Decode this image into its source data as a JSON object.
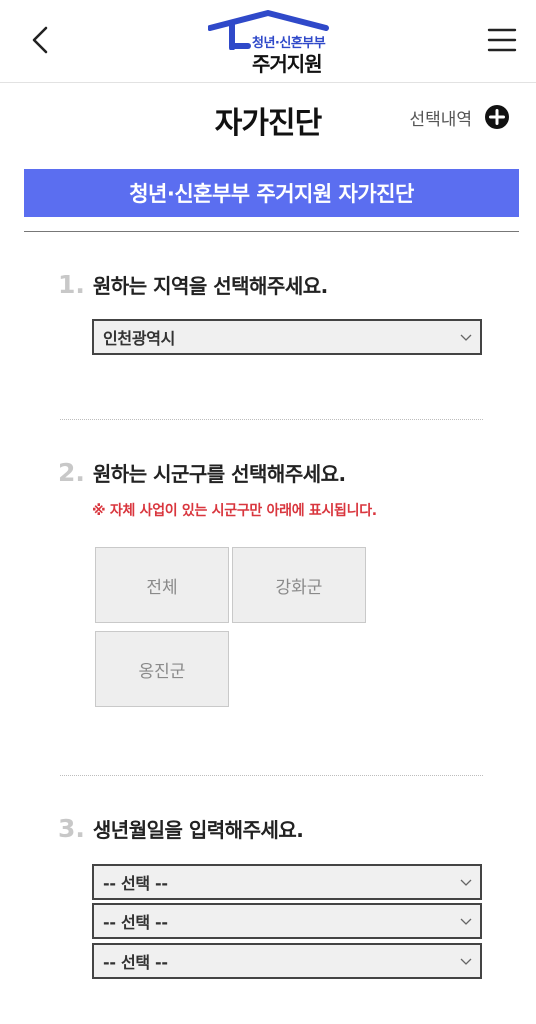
{
  "header": {
    "logo_line1": "청년·신혼부부",
    "logo_line2": "주거지원",
    "colors": {
      "brand_blue": "#2f49c9"
    }
  },
  "page": {
    "title": "자가진단",
    "history_label": "선택내역"
  },
  "banner": {
    "text": "청년·신혼부부 주거지원 자가진단",
    "color": "#5b6ef0"
  },
  "q1": {
    "number": "1.",
    "text": "원하는 지역을 선택해주세요.",
    "selected": "인천광역시"
  },
  "q2": {
    "number": "2.",
    "text": "원하는 시군구를 선택해주세요.",
    "notice": "※ 자체 사업이 있는 시군구만 아래에 표시됩니다.",
    "notice_color": "#d9363e",
    "options": [
      "전체",
      "강화군",
      "옹진군"
    ]
  },
  "q3": {
    "number": "3.",
    "text": "생년월일을 입력해주세요.",
    "year": "-- 선택 --",
    "month": "-- 선택 --",
    "day": "-- 선택 --"
  },
  "icons": [
    "chevron-left-icon",
    "hamburger-menu-icon",
    "house-roof-icon",
    "plus-circle-icon",
    "chevron-down-icon"
  ]
}
